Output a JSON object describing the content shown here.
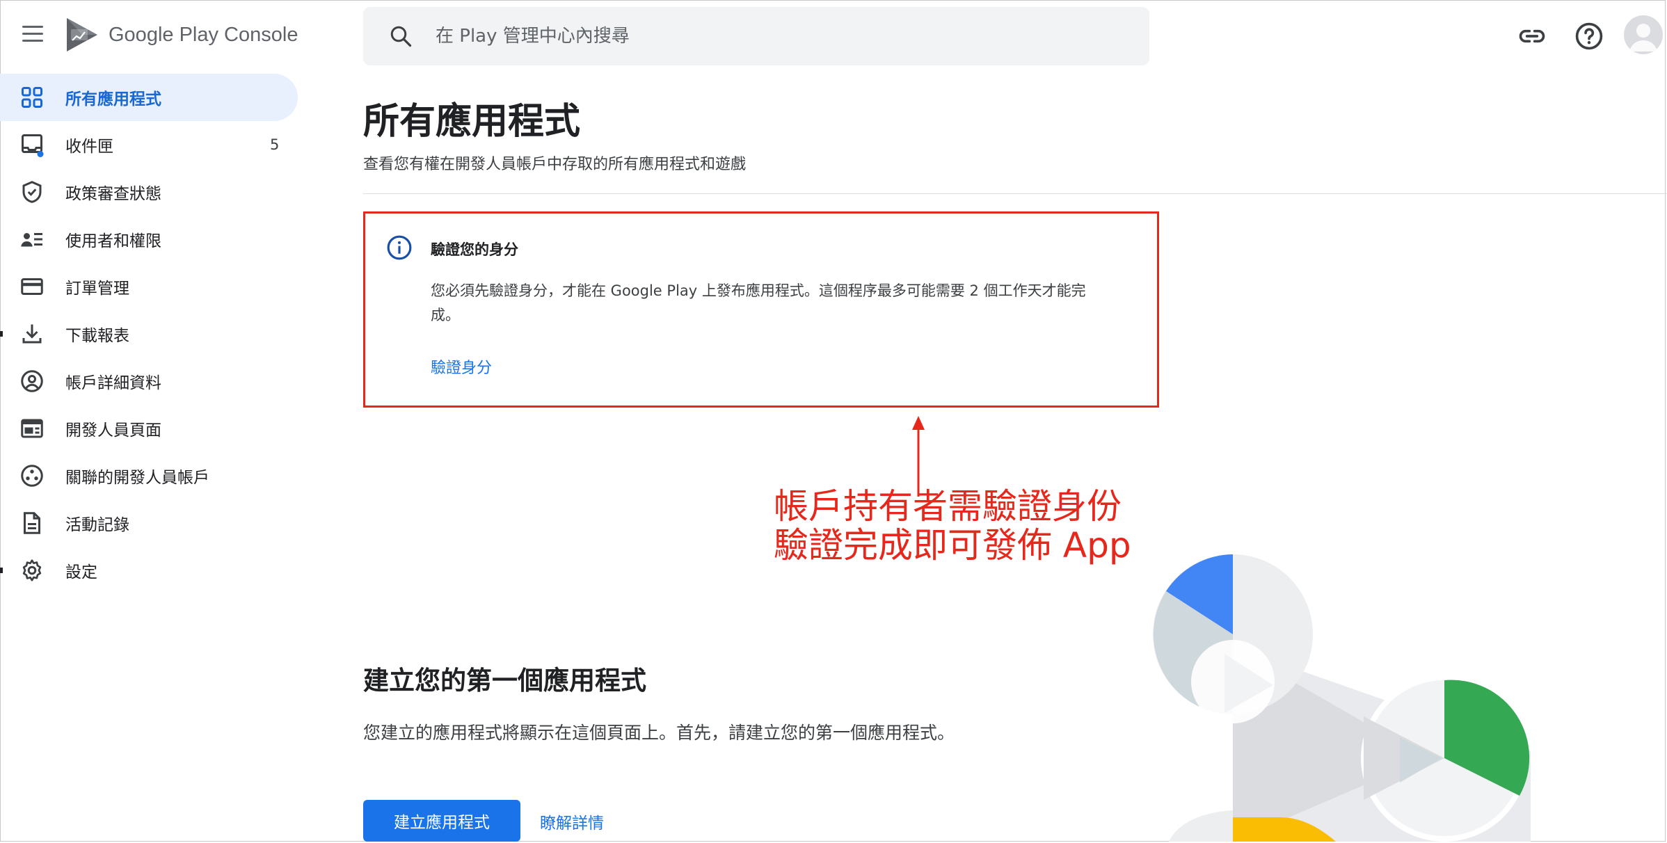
{
  "app": {
    "logo_text": "Google Play Console"
  },
  "search": {
    "placeholder": "在 Play 管理中心內搜尋"
  },
  "sidebar": {
    "items": [
      {
        "label": "所有應用程式",
        "icon": "grid-icon",
        "active": true
      },
      {
        "label": "收件匣",
        "icon": "inbox-icon",
        "count": "5"
      },
      {
        "label": "政策審查狀態",
        "icon": "shield-icon"
      },
      {
        "label": "使用者和權限",
        "icon": "users-icon"
      },
      {
        "label": "訂單管理",
        "icon": "credit-card-icon"
      },
      {
        "label": "下載報表",
        "icon": "download-icon"
      },
      {
        "label": "帳戶詳細資料",
        "icon": "account-circle-icon"
      },
      {
        "label": "開發人員頁面",
        "icon": "web-page-icon"
      },
      {
        "label": "關聯的開發人員帳戶",
        "icon": "linked-accounts-icon"
      },
      {
        "label": "活動記錄",
        "icon": "document-icon"
      },
      {
        "label": "設定",
        "icon": "gear-icon"
      }
    ]
  },
  "main": {
    "title": "所有應用程式",
    "subtitle": "查看您有權在開發人員帳戶中存取的所有應用程式和遊戲",
    "notice": {
      "title": "驗證您的身分",
      "body": "您必須先驗證身分，才能在 Google Play 上發布應用程式。這個程序最多可能需要 2 個工作天才能完成。",
      "link": "驗證身分"
    },
    "annotation": {
      "line1": "帳戶持有者需驗證身份",
      "line2": "驗證完成即可發佈 App",
      "color": "#e5281b"
    },
    "create": {
      "title": "建立您的第一個應用程式",
      "body": "您建立的應用程式將顯示在這個頁面上。首先，請建立您的第一個應用程式。",
      "button": "建立應用程式",
      "learn_more": "瞭解詳情"
    }
  },
  "colors": {
    "accent": "#1a73e8",
    "active_bg": "#e8f0fe"
  }
}
